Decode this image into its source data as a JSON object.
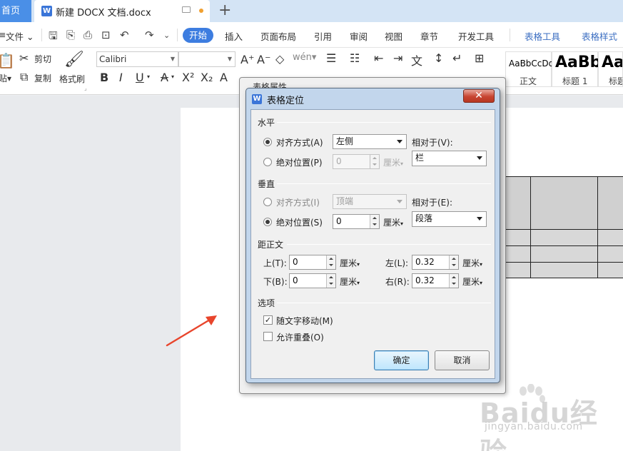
{
  "tabbar": {
    "home_tab": "首页",
    "doc_tab": "新建 DOCX 文档.docx",
    "new_tab": "+"
  },
  "menu": {
    "file": "文件",
    "tabs": [
      "开始",
      "插入",
      "页面布局",
      "引用",
      "审阅",
      "视图",
      "章节",
      "开发工具"
    ],
    "context_tabs": [
      "表格工具",
      "表格样式"
    ],
    "active_tab": "开始"
  },
  "toolbar": {
    "cut": "剪切",
    "paste": "粘贴",
    "copy": "复制",
    "format_painter": "格式刷",
    "font_name": "Calibri",
    "font_size": "",
    "bold": "B",
    "italic": "I",
    "underline": "U",
    "strikethrough": "A",
    "superscript": "X²",
    "subscript": "X₂",
    "styles": [
      {
        "preview": "AaBbCcDd",
        "name": "正文"
      },
      {
        "preview": "AaBb",
        "name": "标题 1"
      },
      {
        "preview": "AaB",
        "name": "标题"
      }
    ]
  },
  "back_dialog": {
    "title": "表格属性"
  },
  "dialog": {
    "title": "表格定位",
    "horizontal": {
      "section": "水平",
      "align_label": "对齐方式(A)",
      "align_value": "左侧",
      "abs_label": "绝对位置(P)",
      "abs_value": "0",
      "abs_unit": "厘米",
      "relative_label": "相对于(V):",
      "relative_value": "栏",
      "selected": "align"
    },
    "vertical": {
      "section": "垂直",
      "align_label": "对齐方式(I)",
      "align_value": "顶端",
      "abs_label": "绝对位置(S)",
      "abs_value": "0",
      "abs_unit": "厘米",
      "relative_label": "相对于(E):",
      "relative_value": "段落",
      "selected": "absolute"
    },
    "distance": {
      "section": "距正文",
      "top_label": "上(T):",
      "top_value": "0",
      "bottom_label": "下(B):",
      "bottom_value": "0",
      "left_label": "左(L):",
      "left_value": "0.32",
      "right_label": "右(R):",
      "right_value": "0.32",
      "unit": "厘米"
    },
    "options": {
      "section": "选项",
      "move_with_text": "随文字移动(M)",
      "move_with_text_checked": true,
      "allow_overlap": "允许重叠(O)",
      "allow_overlap_checked": false
    },
    "ok": "确定",
    "cancel": "取消"
  },
  "watermark": {
    "brand": "Baidu经验",
    "url": "jingyan.baidu.com"
  },
  "colors": {
    "accent": "#3d7de0",
    "context_tab": "#3d6fc2",
    "arrow": "#e8452c",
    "dialog_frame": "#c2d6ec",
    "close_button": "#c74532"
  }
}
